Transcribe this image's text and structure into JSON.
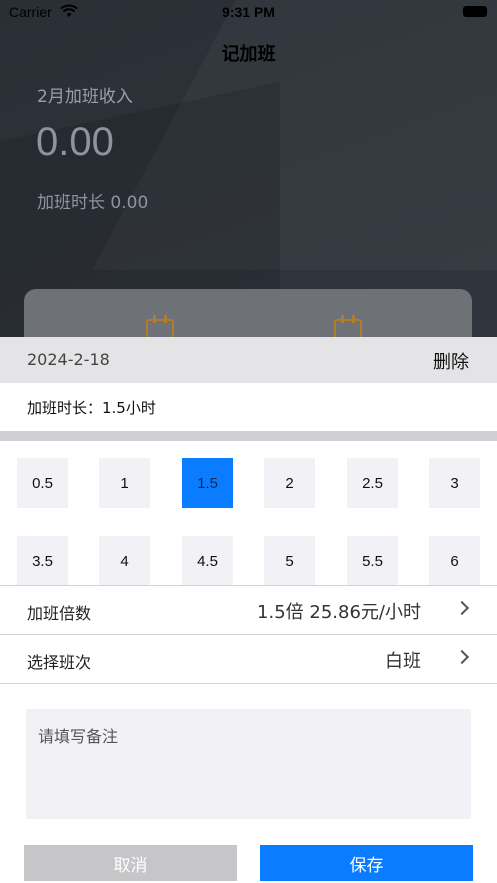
{
  "status_bar": {
    "carrier": "Carrier",
    "time": "9:31 PM"
  },
  "nav": {
    "title": "记加班"
  },
  "summary": {
    "month_income_label": "2月加班收入",
    "income_value": "0.00",
    "hours_text": "加班时长 0.00"
  },
  "sheet": {
    "date": "2024-2-18",
    "delete_label": "删除",
    "duration_text": "加班时长：1.5小时",
    "hour_options": [
      "0.5",
      "1",
      "1.5",
      "2",
      "2.5",
      "3",
      "3.5",
      "4",
      "4.5",
      "5",
      "5.5",
      "6"
    ],
    "selected_hours": "1.5",
    "multiplier_label": "加班倍数",
    "multiplier_value": "1.5倍 25.86元/小时",
    "shift_label": "选择班次",
    "shift_value": "白班",
    "note_placeholder": "请填写备注",
    "cancel_label": "取消",
    "save_label": "保存"
  },
  "colors": {
    "accent": "#0a7cff",
    "cancel": "#c6c6c8",
    "icon": "#b07d2c"
  },
  "icons": [
    "wifi-icon",
    "battery-icon",
    "calendar-icon",
    "chevron-right-icon"
  ]
}
